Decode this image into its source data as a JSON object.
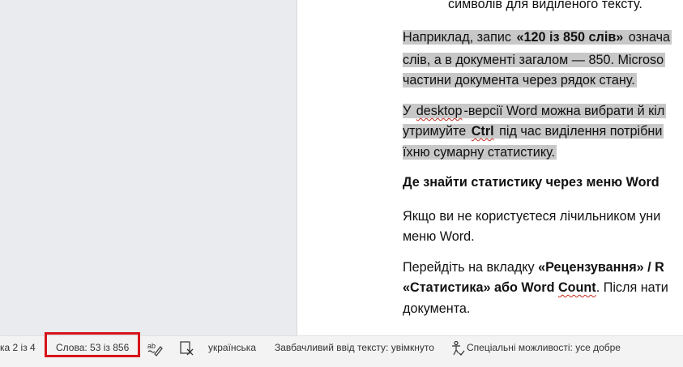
{
  "document": {
    "lines": [
      {
        "segments": [
          {
            "text": "символів для виділеного тексту."
          }
        ]
      },
      {
        "segments": [
          {
            "text": "Наприклад, запис ",
            "hl": true
          },
          {
            "text": "«120 із 850 слів»",
            "hl": true,
            "bold": true
          },
          {
            "text": " означа",
            "hl": true
          }
        ]
      },
      {
        "segments": [
          {
            "text": "слів, а в документі загалом — 850. Microso",
            "hl": true
          }
        ]
      },
      {
        "segments": [
          {
            "text": "частини документа через рядок стану. ",
            "hl": true
          }
        ]
      },
      {
        "segments": [
          {
            "text": "У ",
            "hl": true
          },
          {
            "text": "desktop",
            "hl": true,
            "spell": true
          },
          {
            "text": "-версії Word можна вибрати й кіл",
            "hl": true
          }
        ]
      },
      {
        "segments": [
          {
            "text": "утримуйте ",
            "hl": true
          },
          {
            "text": "Ctrl",
            "hl": true,
            "bold": true,
            "spell": true
          },
          {
            "text": " під час виділення потрібни",
            "hl": true
          }
        ]
      },
      {
        "segments": [
          {
            "text": "їхню сумарну статистику. ",
            "hl": true
          }
        ]
      },
      {
        "segments": [
          {
            "text": "Де знайти статистику через меню Word",
            "bold": true
          }
        ]
      },
      {
        "segments": [
          {
            "text": "Якщо ви не користуєтеся лічильником уни"
          }
        ]
      },
      {
        "segments": [
          {
            "text": "меню Word."
          }
        ]
      },
      {
        "segments": [
          {
            "text": "Перейдіть на вкладку "
          },
          {
            "text": "«Рецензування» / R",
            "bold": true
          }
        ]
      },
      {
        "segments": [
          {
            "text": "«Статистика» або ",
            "bold": true
          },
          {
            "text": "Word",
            "bold": true
          },
          {
            "text": " ",
            "bold": true
          },
          {
            "text": "Count",
            "bold": true,
            "spell": true
          },
          {
            "text": ". Після нати"
          }
        ]
      },
      {
        "segments": [
          {
            "text": "документа."
          }
        ]
      }
    ]
  },
  "statusbar": {
    "page_label": "ка 2 із 4",
    "words_label": "Слова: 53 із 856",
    "proofing_icon": "spell-check-icon",
    "language": "українська",
    "language_icon": "language-check-icon",
    "predictive_text": "Завбачливий ввід тексту: увімкнуто",
    "accessibility_icon": "accessibility-icon",
    "accessibility": "Спеціальні можливості: усе добре",
    "highlight_color": "#d7141a"
  }
}
